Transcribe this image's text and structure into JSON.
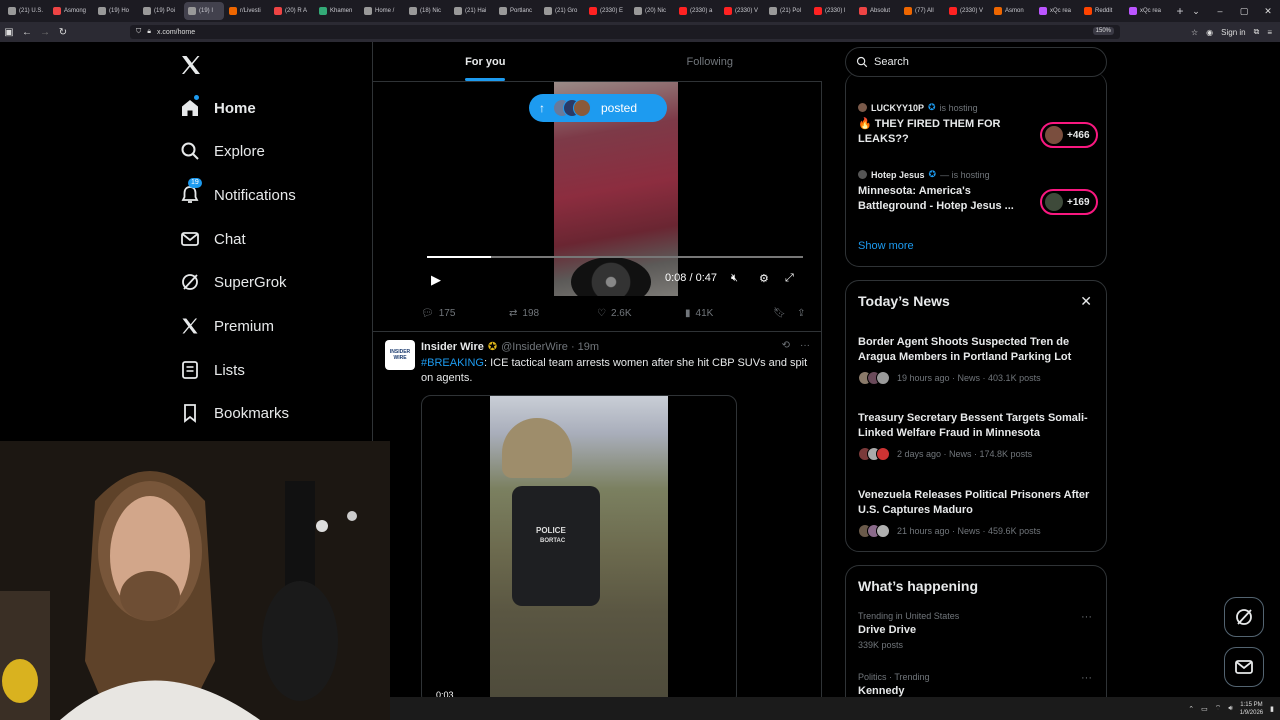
{
  "browser": {
    "tabs": [
      {
        "label": "(21) U.S."
      },
      {
        "label": "Asmong"
      },
      {
        "label": "(19) Ho"
      },
      {
        "label": "(19) Poi"
      },
      {
        "label": "(19) I"
      },
      {
        "label": "r/Livesti"
      },
      {
        "label": "(20) R A"
      },
      {
        "label": "Khamen"
      },
      {
        "label": "Home /"
      },
      {
        "label": "(18) Nic"
      },
      {
        "label": "(21) Hai"
      },
      {
        "label": "Portlanc"
      },
      {
        "label": "(21) Gro"
      },
      {
        "label": "(2330) E"
      },
      {
        "label": "(20) Nic"
      },
      {
        "label": "(2330) a"
      },
      {
        "label": "(2330) V"
      },
      {
        "label": "(21) Pol"
      },
      {
        "label": "(2330) l"
      },
      {
        "label": "Absolut"
      },
      {
        "label": "(77) All"
      },
      {
        "label": "(2330) V"
      },
      {
        "label": "Asmon"
      },
      {
        "label": "xQc rea"
      },
      {
        "label": "Reddit"
      },
      {
        "label": "xQc rea"
      }
    ],
    "new_tab": "+",
    "url": "x.com/home",
    "zoom": "150%",
    "sign_in": "Sign in"
  },
  "nav": {
    "items": [
      {
        "label": "Home"
      },
      {
        "label": "Explore"
      },
      {
        "label": "Notifications",
        "badge": "19"
      },
      {
        "label": "Chat"
      },
      {
        "label": "SuperGrok"
      },
      {
        "label": "Premium"
      },
      {
        "label": "Lists"
      },
      {
        "label": "Bookmarks"
      }
    ]
  },
  "feed": {
    "tabs": [
      "For you",
      "Following"
    ],
    "posted_pill": "posted",
    "video1": {
      "time": "0:08 / 0:47",
      "progress": 0.17
    },
    "actions1": {
      "replies": "175",
      "reposts": "198",
      "likes": "2.6K",
      "views": "41K"
    },
    "tweet2": {
      "avatar_line1": "INSIDER",
      "avatar_line2": "WIRE",
      "name": "Insider Wire",
      "handle": "@InsiderWire · 19m",
      "hashtag": "#BREAKING",
      "text": ": ICE tactical team arrests women after she hit CBP SUVs and spit on agents.",
      "vest_line1": "POLICE",
      "vest_line2": "BORTAC",
      "video_time": "0:03"
    }
  },
  "right": {
    "search_placeholder": "Search",
    "spaces": [
      {
        "host": "LUCKYY10P",
        "hosting": "is hosting",
        "title": "🔥 THEY FIRED THEM FOR LEAKS??",
        "listeners": "+466"
      },
      {
        "host": "Hotep Jesus",
        "hosting": "— is hosting",
        "title": "Minnesota: America's Battleground - Hotep Jesus ...",
        "listeners": "+169"
      }
    ],
    "show_more": "Show more",
    "news_title": "Today’s News",
    "news": [
      {
        "title": "Border Agent Shoots Suspected Tren de Aragua Members in Portland Parking Lot",
        "meta": "19 hours ago · News · 403.1K posts"
      },
      {
        "title": "Treasury Secretary Bessent Targets Somali-Linked Welfare Fraud in Minnesota",
        "meta": "2 days ago · News · 174.8K posts"
      },
      {
        "title": "Venezuela Releases Political Prisoners After U.S. Captures Maduro",
        "meta": "21 hours ago · News · 459.6K posts"
      }
    ],
    "whats_title": "What’s happening",
    "trends": [
      {
        "category": "Trending in United States",
        "name": "Drive Drive",
        "count": "339K posts"
      },
      {
        "category": "Politics · Trending",
        "name": "Kennedy",
        "count": ""
      }
    ]
  },
  "taskbar": {
    "time": "1:15 PM",
    "date": "1/9/2026"
  },
  "colors": {
    "accent": "#1d9bf0",
    "background": "#000000",
    "border": "#2f3336",
    "muted": "#71767b",
    "live": "#f91880"
  }
}
